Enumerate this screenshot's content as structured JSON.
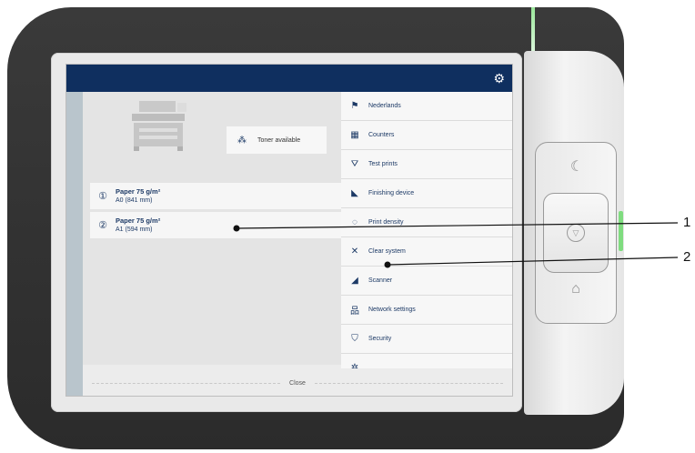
{
  "topbar": {
    "settings_icon": "gear-icon"
  },
  "status": {
    "toner_label": "Toner available",
    "toner_icon": "toner-dots-icon"
  },
  "paper": [
    {
      "number": "①",
      "title": "Paper 75 g/m²",
      "size": "A0 (841 mm)"
    },
    {
      "number": "②",
      "title": "Paper 75 g/m²",
      "size": "A1 (594 mm)"
    }
  ],
  "menu": [
    {
      "label": "Nederlands",
      "icon": "flag-icon",
      "glyph": "⚑"
    },
    {
      "label": "Counters",
      "icon": "counter-icon",
      "glyph": "▦"
    },
    {
      "label": "Test prints",
      "icon": "test-print-icon",
      "glyph": "⛛"
    },
    {
      "label": "Finishing device",
      "icon": "finishing-device-icon",
      "glyph": "◣"
    },
    {
      "label": "Print density",
      "icon": "print-density-icon",
      "glyph": "◌"
    },
    {
      "label": "Clear system",
      "icon": "clear-system-icon",
      "glyph": "✕"
    },
    {
      "label": "Scanner",
      "icon": "scanner-icon",
      "glyph": "◢"
    },
    {
      "label": "Network settings",
      "icon": "network-icon",
      "glyph": "品"
    },
    {
      "label": "Security",
      "icon": "shield-icon",
      "glyph": "⛉"
    },
    {
      "label": "",
      "icon": "settings-more-icon",
      "glyph": "✲"
    }
  ],
  "footer": {
    "close_label": "Close"
  },
  "hardware": {
    "sleep_icon": "moon-icon",
    "start_icon": "start-icon",
    "home_icon": "home-icon"
  },
  "callouts": [
    "1",
    "2"
  ],
  "colors": {
    "topbar": "#0f2f5f",
    "text": "#1d3a66",
    "led": "#7fdc7f"
  }
}
